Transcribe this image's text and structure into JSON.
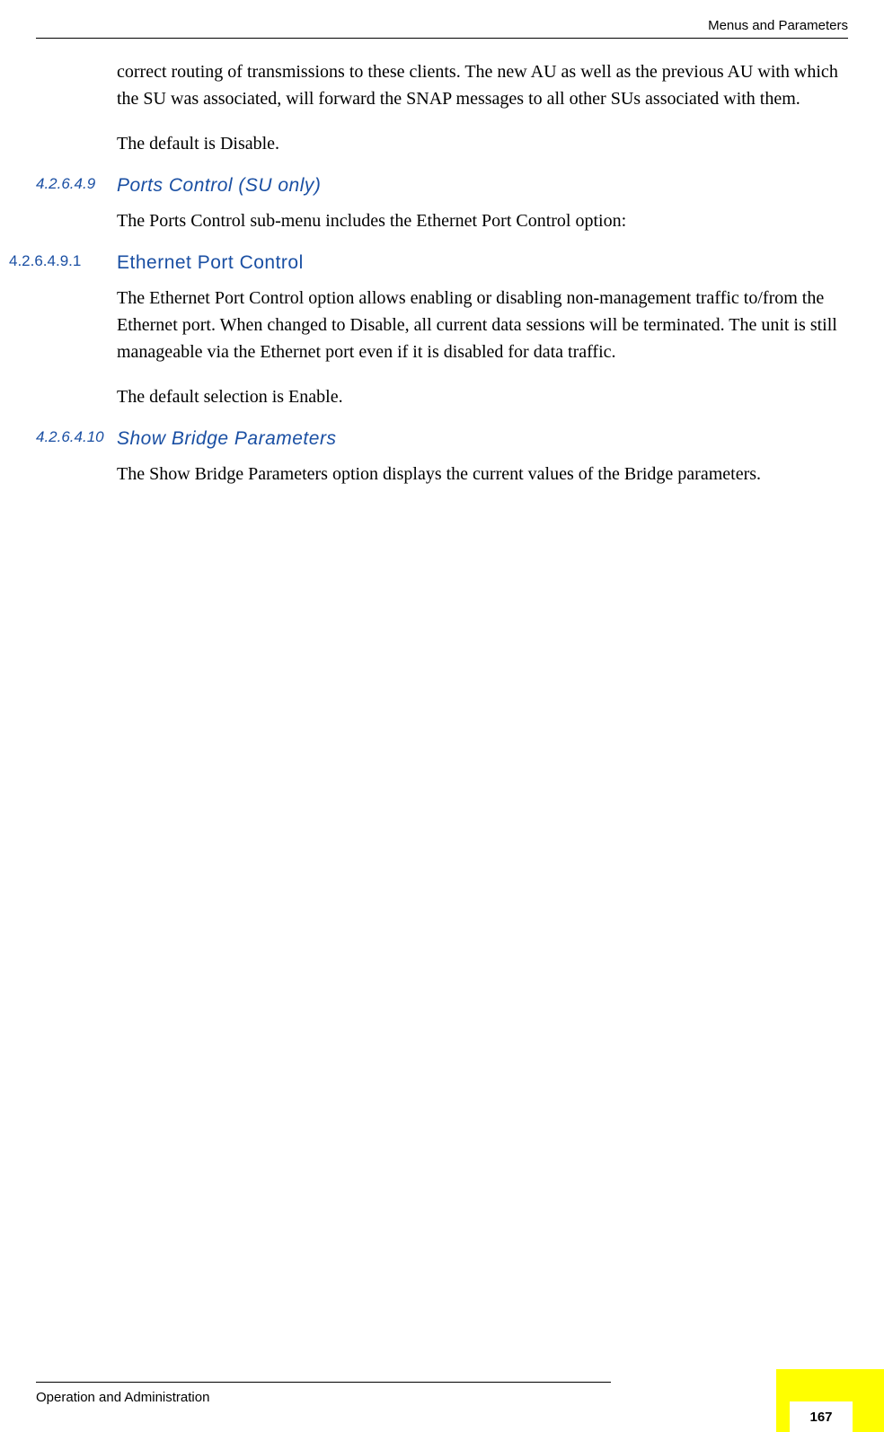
{
  "header": {
    "title": "Menus and Parameters"
  },
  "body": {
    "para1": "correct routing of transmissions to these clients. The new AU as well as the previous AU with which the SU was associated, will forward the SNAP messages to all other SUs associated with them.",
    "para2": "The default is Disable.",
    "section1": {
      "number": "4.2.6.4.9",
      "title": "Ports Control (SU only)"
    },
    "para3": "The Ports Control sub-menu includes the Ethernet Port Control option:",
    "section2": {
      "number": "4.2.6.4.9.1",
      "title": "Ethernet Port Control"
    },
    "para4": "The Ethernet Port Control option allows enabling or disabling non-management traffic to/from the Ethernet port. When changed to Disable, all current data sessions will be terminated. The unit is still manageable via the Ethernet port even if it is disabled for data traffic.",
    "para5": "The default selection is Enable.",
    "section3": {
      "number": "4.2.6.4.10",
      "title": "Show Bridge Parameters"
    },
    "para6": "The Show Bridge Parameters option displays the current values of the Bridge parameters."
  },
  "footer": {
    "text": "Operation and Administration",
    "page_number": "167"
  }
}
